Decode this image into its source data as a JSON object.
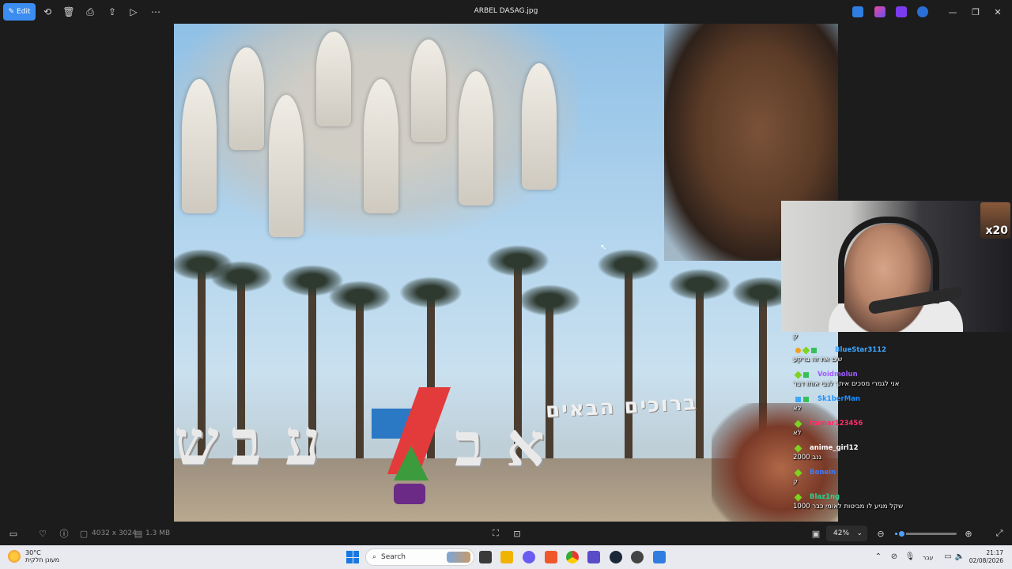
{
  "titlebar": {
    "edit_label": "Edit",
    "file_name": "ARBEL DASAG.jpg"
  },
  "image": {
    "sign_text": "ברוכים הבאים",
    "sign_letters": [
      "ש",
      "ב",
      "ע",
      "ב",
      "א"
    ]
  },
  "stream": {
    "badge_text": "x20",
    "chat": [
      {
        "user": "",
        "message": "ק",
        "color": "#c0c0c0"
      },
      {
        "user": "BlueStar3112",
        "message": "שים את זה ברקע",
        "color": "#3ea6ff"
      },
      {
        "user": "Voidmolun",
        "message": "אני לגמרי מסכים איתך לגבי אותו דבר",
        "color": "#9d5cff"
      },
      {
        "user": "Sk1berMan",
        "message": "לא",
        "color": "#1e90ff"
      },
      {
        "user": "Itamar123456",
        "message": "לא",
        "color": "#ff2f6a"
      },
      {
        "user": "anime_girl12",
        "message": "גנב 2000",
        "color": "#ffffff"
      },
      {
        "user": "Bonein",
        "message": "ק",
        "color": "#3e7bff"
      },
      {
        "user": "Blaz1ng",
        "message": "שקל מגיע לו מביטות לאומי כבר 1000",
        "color": "#2fd08f"
      }
    ]
  },
  "bottombar": {
    "dimensions": "4032 x 3024",
    "file_size": "1.3 MB",
    "zoom": "42%",
    "zoom_level": 0.1
  },
  "taskbar": {
    "temperature": "30°C",
    "weather_desc": "מעונן חלקית",
    "search_placeholder": "Search",
    "language": "עבר",
    "time": "21:17",
    "date": "02/08/2026"
  },
  "colors": {
    "accent": "#3c8df0",
    "background": "#1c1c1c",
    "taskbar": "#e8eaf0"
  }
}
